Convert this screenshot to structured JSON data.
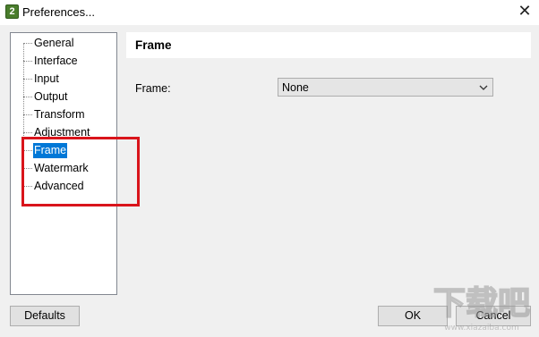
{
  "window": {
    "title": "Preferences...",
    "app_icon_text": "2",
    "close_glyph": "✕"
  },
  "tree": {
    "items": [
      {
        "label": "General",
        "selected": false
      },
      {
        "label": "Interface",
        "selected": false
      },
      {
        "label": "Input",
        "selected": false
      },
      {
        "label": "Output",
        "selected": false
      },
      {
        "label": "Transform",
        "selected": false
      },
      {
        "label": "Adjustment",
        "selected": false
      },
      {
        "label": "Frame",
        "selected": true
      },
      {
        "label": "Watermark",
        "selected": false
      },
      {
        "label": "Advanced",
        "selected": false
      }
    ]
  },
  "panel": {
    "title": "Frame",
    "frame_label": "Frame:",
    "frame_value": "None"
  },
  "buttons": {
    "defaults": "Defaults",
    "ok": "OK",
    "cancel": "Cancel"
  },
  "watermark": {
    "text": "下载吧",
    "url": "www.xiazaiba.com"
  },
  "colors": {
    "selection": "#0078d7",
    "highlight_box": "#d9141b",
    "dialog_bg": "#f0f0f0"
  }
}
